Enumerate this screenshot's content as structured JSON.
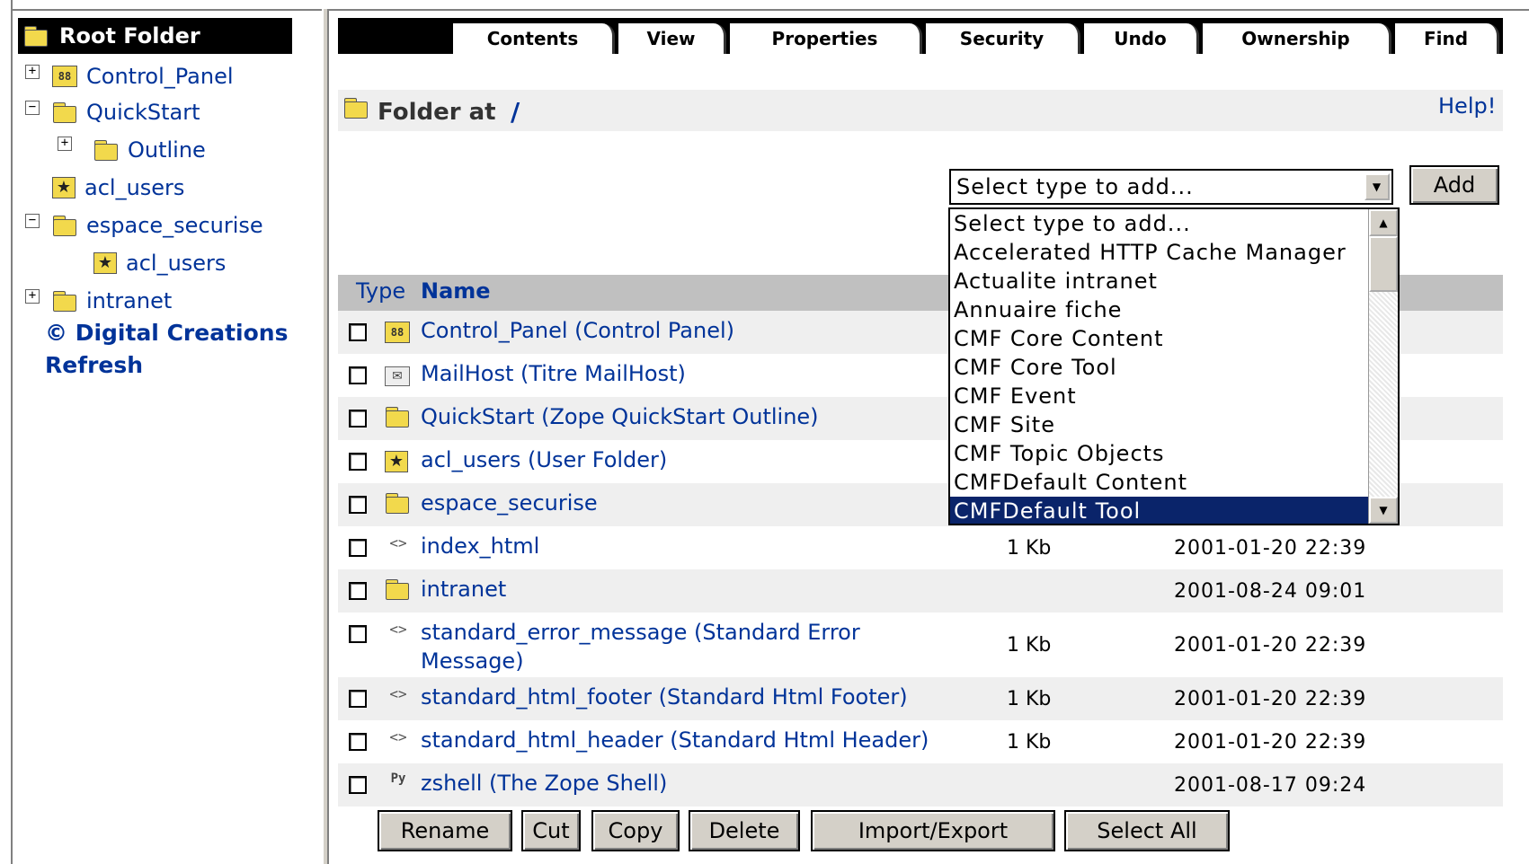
{
  "tree": {
    "root_label": "Root Folder",
    "items": [
      {
        "label": "Control_Panel",
        "expander": "+"
      },
      {
        "label": "QuickStart",
        "expander": "−"
      },
      {
        "label": "Outline",
        "expander": "+"
      },
      {
        "label": "acl_users",
        "expander": ""
      },
      {
        "label": "espace_securise",
        "expander": "−"
      },
      {
        "label": "acl_users",
        "expander": ""
      },
      {
        "label": "intranet",
        "expander": "+"
      }
    ],
    "copyright": "© Digital Creations",
    "refresh": "Refresh"
  },
  "tabs": [
    "Contents",
    "View",
    "Properties",
    "Security",
    "Undo",
    "Ownership",
    "Find"
  ],
  "active_tab": "Contents",
  "header": {
    "folder_at": "Folder at",
    "path": "/",
    "help": "Help!"
  },
  "add": {
    "select_value": "Select type to add...",
    "button": "Add",
    "options": [
      "Select type to add...",
      "Accelerated HTTP Cache Manager",
      "Actualite intranet",
      "Annuaire fiche",
      "CMF Core Content",
      "CMF Core Tool",
      "CMF Event",
      "CMF Site",
      "CMF Topic Objects",
      "CMFDefault Content",
      "CMFDefault Tool"
    ],
    "highlighted": "CMFDefault Tool"
  },
  "table": {
    "col_type": "Type",
    "col_name": "Name",
    "rows": [
      {
        "name": "Control_Panel (Control Panel)",
        "size": "",
        "date": ""
      },
      {
        "name": "MailHost (Titre MailHost)",
        "size": "",
        "date": ""
      },
      {
        "name": "QuickStart (Zope QuickStart Outline)",
        "size": "",
        "date": ""
      },
      {
        "name": "acl_users (User Folder)",
        "size": "",
        "date": ""
      },
      {
        "name": "espace_securise",
        "size": "",
        "date": ""
      },
      {
        "name": "index_html",
        "size": "1 Kb",
        "date": "2001-01-20 22:39"
      },
      {
        "name": "intranet",
        "size": "",
        "date": "2001-08-24 09:01"
      },
      {
        "name": "standard_error_message (Standard Error",
        "name2": "Message)",
        "size": "1 Kb",
        "date": "2001-01-20 22:39"
      },
      {
        "name": "standard_html_footer (Standard Html Footer)",
        "size": "1 Kb",
        "date": "2001-01-20 22:39"
      },
      {
        "name": "standard_html_header (Standard Html Header)",
        "size": "1 Kb",
        "date": "2001-01-20 22:39"
      },
      {
        "name": "zshell (The Zope Shell)",
        "size": "",
        "date": "2001-08-17 09:24"
      }
    ]
  },
  "buttons": [
    "Rename",
    "Cut",
    "Copy",
    "Delete",
    "Import/Export",
    "Select All"
  ],
  "icons": {
    "folder": "folder-icon",
    "control_panel": "control-panel-icon",
    "user_folder": "user-folder-icon",
    "mailhost": "mailhost-icon",
    "dtml": "dtml-method-icon",
    "python": "python-script-icon"
  }
}
